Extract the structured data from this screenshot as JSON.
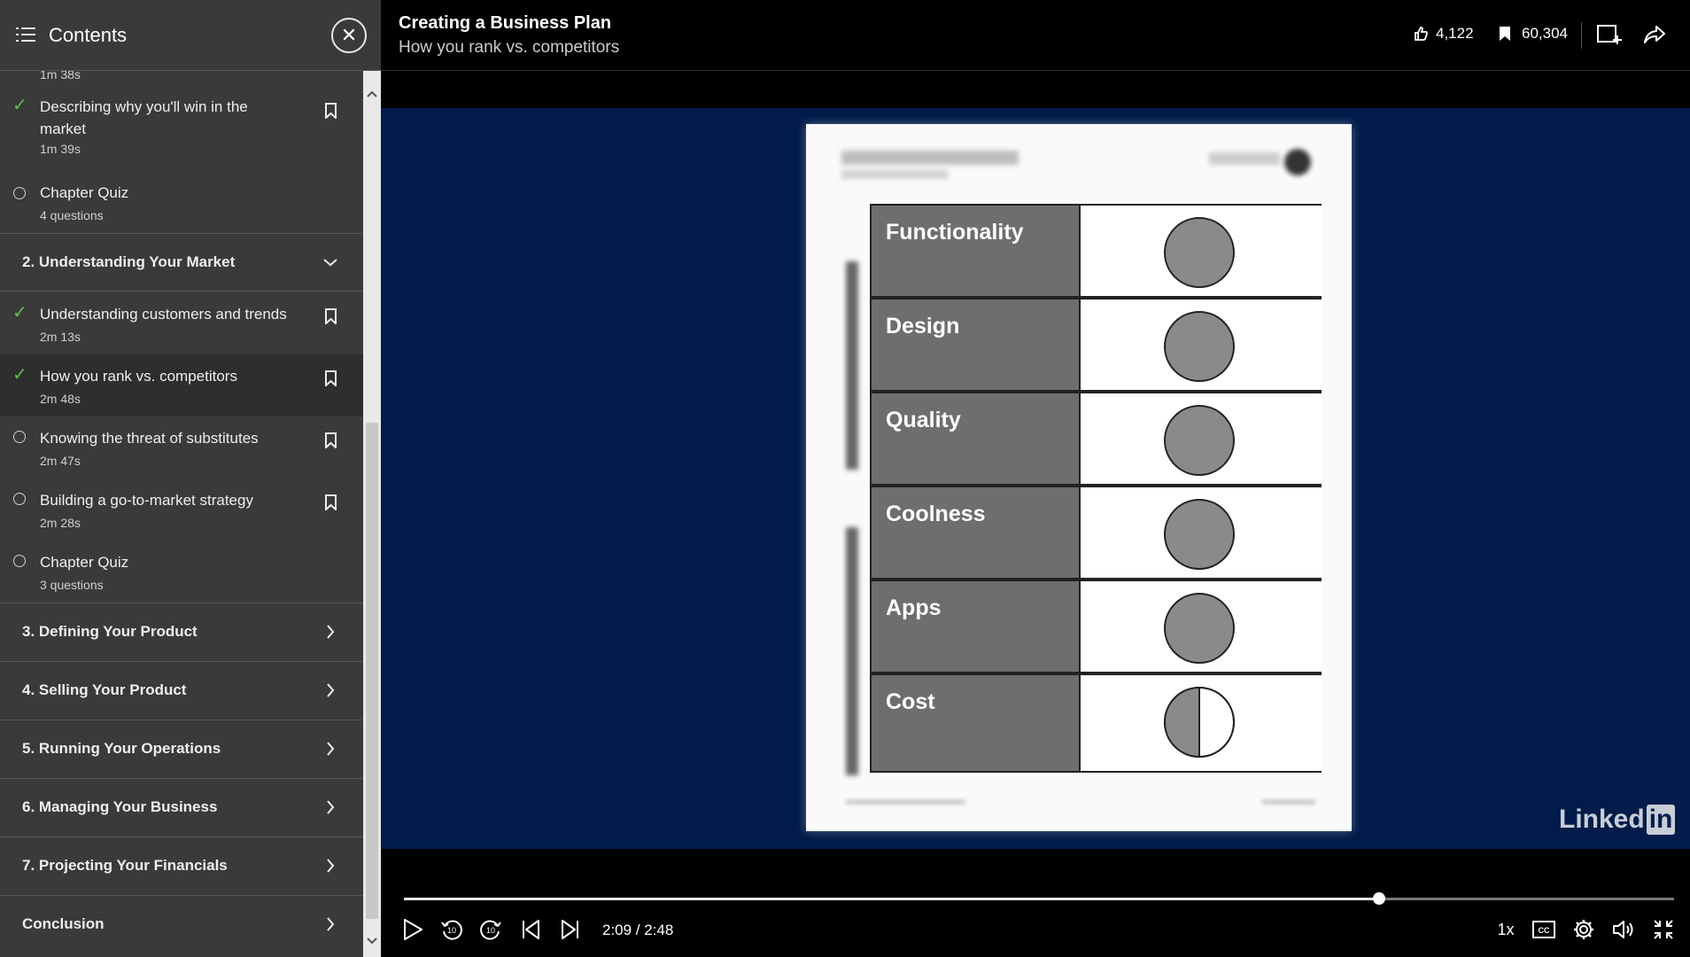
{
  "sidebar": {
    "title": "Contents",
    "partial_duration": "1m 38s",
    "items": [
      {
        "title": "Describing why you'll win in the market",
        "duration": "1m 39s",
        "status": "complete"
      },
      {
        "title": "Chapter Quiz",
        "duration": "4 questions",
        "status": "incomplete"
      }
    ],
    "chapter2": {
      "title": "2. Understanding Your Market",
      "items": [
        {
          "title": "Understanding customers and trends",
          "duration": "2m 13s",
          "status": "complete"
        },
        {
          "title": "How you rank vs. competitors",
          "duration": "2m 48s",
          "status": "complete",
          "active": true
        },
        {
          "title": "Knowing the threat of substitutes",
          "duration": "2m 47s",
          "status": "incomplete"
        },
        {
          "title": "Building a go-to-market strategy",
          "duration": "2m 28s",
          "status": "incomplete"
        },
        {
          "title": "Chapter Quiz",
          "duration": "3 questions",
          "status": "incomplete"
        }
      ]
    },
    "chapters": [
      {
        "title": "3. Defining Your Product"
      },
      {
        "title": "4. Selling Your Product"
      },
      {
        "title": "5. Running Your Operations"
      },
      {
        "title": "6. Managing Your Business"
      },
      {
        "title": "7. Projecting Your Financials"
      },
      {
        "title": "Conclusion"
      }
    ]
  },
  "header": {
    "course_title": "Creating a Business Plan",
    "video_title": "How you rank vs. competitors",
    "likes": "4,122",
    "saves": "60,304"
  },
  "video_content": {
    "rows": [
      {
        "label": "Functionality",
        "fill": "full"
      },
      {
        "label": "Design",
        "fill": "full"
      },
      {
        "label": "Quality",
        "fill": "full"
      },
      {
        "label": "Coolness",
        "fill": "full"
      },
      {
        "label": "Apps",
        "fill": "full"
      },
      {
        "label": "Cost",
        "fill": "half"
      }
    ],
    "watermark": "Linked",
    "watermark_in": "in"
  },
  "player": {
    "current_time": "2:09",
    "total_time": "2:48",
    "time_display": "2:09 / 2:48",
    "progress_fraction": 0.768,
    "speed": "1x"
  },
  "colors": {
    "sidebar_bg": "#3a3a3a",
    "check_green": "#5fbf4c",
    "video_bg": "#011c4a"
  }
}
